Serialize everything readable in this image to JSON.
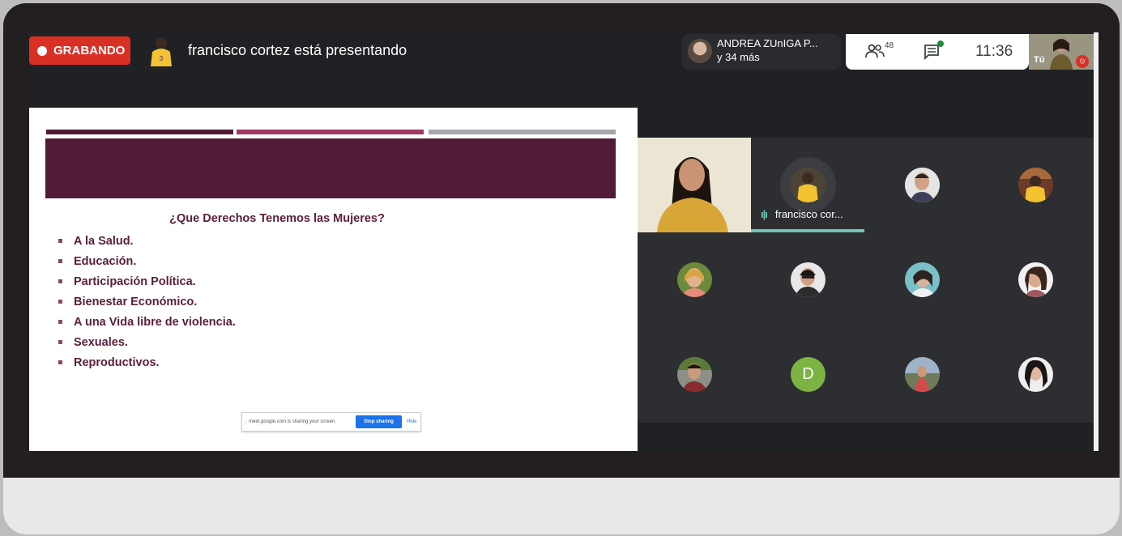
{
  "topbar": {
    "recording_label": "GRABANDO",
    "presenting_text": "francisco cortez está presentando",
    "active_speaker": {
      "name": "ANDREA ZUnIGA P...",
      "more": "y 34 más"
    },
    "participants_count": "48",
    "time": "11:36",
    "self_label": "Tú"
  },
  "slide": {
    "title": "¿Que Derechos Tenemos las Mujeres?",
    "bullets": [
      "A la Salud.",
      "Educación.",
      "Participación Política.",
      "Bienestar Económico.",
      "A una Vida libre de violencia.",
      "Sexuales.",
      "Reproductivos."
    ],
    "share_notice": {
      "message": "meet.google.com is sharing your screen.",
      "stop_label": "Stop sharing",
      "hide_label": "Hide"
    }
  },
  "grid": {
    "presenter_name": "francisco cor...",
    "letter_avatar": "D"
  },
  "colors": {
    "record_red": "#d93025",
    "slide_banner": "#521c36",
    "slide_text": "#5a1e3a",
    "presenter_underline": "#6cc7b9",
    "letter_avatar_bg": "#7cb342"
  },
  "icons": [
    "record-dot-icon",
    "people-icon",
    "chat-icon",
    "mic-off-icon",
    "audio-wave-icon"
  ]
}
